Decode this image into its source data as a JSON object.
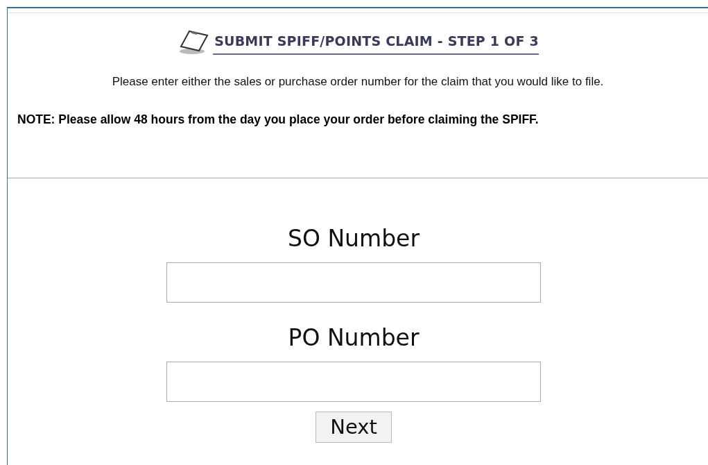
{
  "heading": "SUBMIT SPIFF/POINTS CLAIM - STEP 1 OF 3",
  "instructions": "Please enter either the sales or purchase order number for the claim that you would like to file.",
  "note": "NOTE: Please allow 48 hours from the day you place your order before claiming the SPIFF.",
  "fields": [
    {
      "label": "SO Number"
    },
    {
      "label": "PO Number"
    }
  ],
  "button": "Next"
}
